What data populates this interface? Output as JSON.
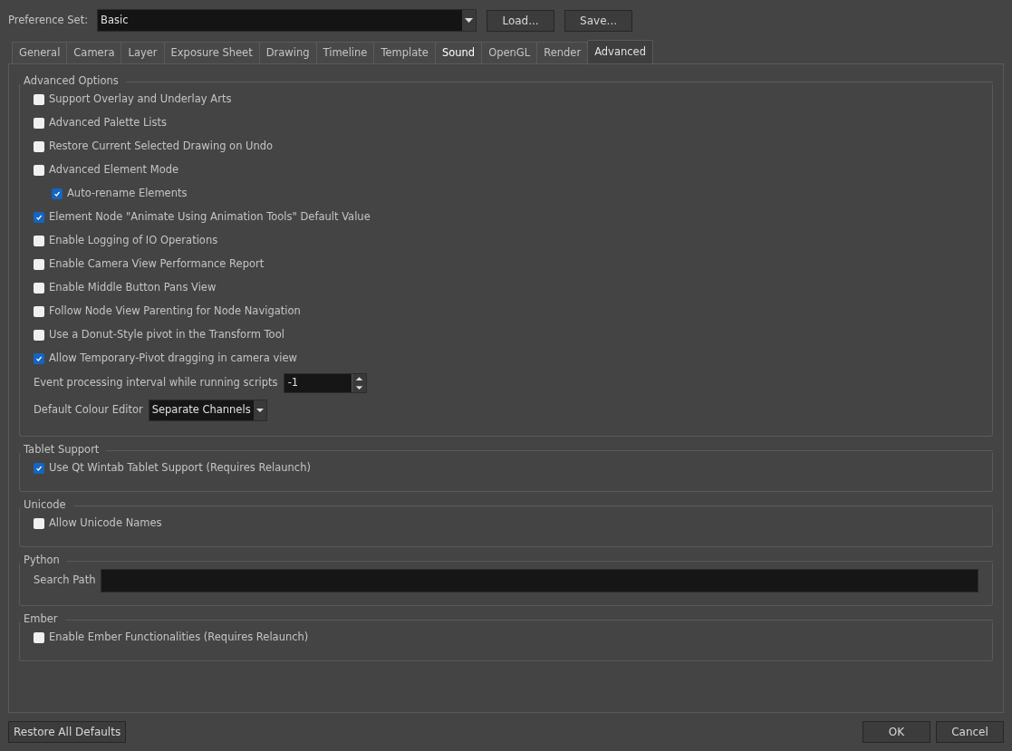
{
  "preference_set": {
    "label": "Preference Set:",
    "value": "Basic",
    "buttons": [
      "Load...",
      "Save..."
    ]
  },
  "tabs": [
    {
      "label": "General",
      "selected": false,
      "hovered": false
    },
    {
      "label": "Camera",
      "selected": false,
      "hovered": false
    },
    {
      "label": "Layer",
      "selected": false,
      "hovered": false
    },
    {
      "label": "Exposure Sheet",
      "selected": false,
      "hovered": false
    },
    {
      "label": "Drawing",
      "selected": false,
      "hovered": false
    },
    {
      "label": "Timeline",
      "selected": false,
      "hovered": false
    },
    {
      "label": "Template",
      "selected": false,
      "hovered": false
    },
    {
      "label": "Sound",
      "selected": false,
      "hovered": true
    },
    {
      "label": "OpenGL",
      "selected": false,
      "hovered": false
    },
    {
      "label": "Render",
      "selected": false,
      "hovered": false
    },
    {
      "label": "Advanced",
      "selected": true,
      "hovered": false
    }
  ],
  "groups": [
    {
      "title": "Advanced Options",
      "items": [
        {
          "kind": "checkbox",
          "label": "Support Overlay and Underlay Arts",
          "checked": false
        },
        {
          "kind": "checkbox",
          "label": "Advanced Palette Lists",
          "checked": false
        },
        {
          "kind": "checkbox",
          "label": "Restore Current Selected Drawing on Undo",
          "checked": false
        },
        {
          "kind": "checkbox",
          "label": "Advanced Element Mode",
          "checked": false,
          "children": [
            {
              "kind": "checkbox",
              "label": "Auto-rename Elements",
              "checked": true
            }
          ]
        },
        {
          "kind": "checkbox",
          "label": "Element Node \"Animate Using Animation Tools\" Default Value",
          "checked": true
        },
        {
          "kind": "checkbox",
          "label": "Enable Logging of IO Operations",
          "checked": false
        },
        {
          "kind": "checkbox",
          "label": "Enable Camera View Performance Report",
          "checked": false
        },
        {
          "kind": "checkbox",
          "label": "Enable Middle Button Pans View",
          "checked": false
        },
        {
          "kind": "checkbox",
          "label": "Follow Node View Parenting for Node Navigation",
          "checked": false
        },
        {
          "kind": "checkbox",
          "label": "Use a Donut-Style pivot in the Transform Tool",
          "checked": false
        },
        {
          "kind": "checkbox",
          "label": "Allow Temporary-Pivot dragging in camera view",
          "checked": true
        },
        {
          "kind": "spinbox",
          "label": "Event processing interval while running scripts",
          "value": "-1"
        },
        {
          "kind": "dropdown",
          "label": "Default Colour Editor",
          "value": "Separate Channels"
        }
      ]
    },
    {
      "title": "Tablet Support",
      "items": [
        {
          "kind": "checkbox",
          "label": "Use Qt Wintab Tablet Support (Requires Relaunch)",
          "checked": true
        }
      ]
    },
    {
      "title": "Unicode",
      "items": [
        {
          "kind": "checkbox",
          "label": "Allow Unicode Names",
          "checked": false
        }
      ]
    },
    {
      "title": "Python",
      "items": [
        {
          "kind": "textfield",
          "label": "Search Path"
        }
      ]
    },
    {
      "title": "Ember",
      "items": [
        {
          "kind": "checkbox",
          "label": "Enable Ember Functionalities (Requires Relaunch)",
          "checked": false
        }
      ]
    }
  ],
  "footer": {
    "restore": "Restore All Defaults",
    "buttons": [
      "OK",
      "Cancel"
    ]
  }
}
